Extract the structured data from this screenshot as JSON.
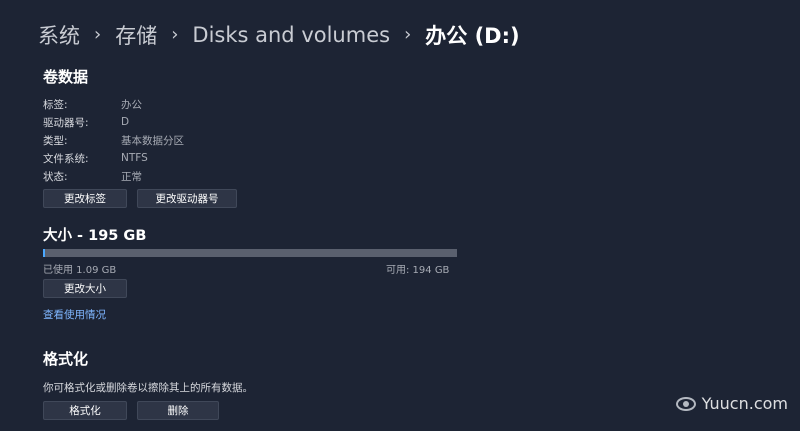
{
  "breadcrumb": {
    "items": [
      "系统",
      "存储",
      "Disks and volumes",
      "办公 (D:)"
    ],
    "separator": "›"
  },
  "volume_data": {
    "title": "卷数据",
    "properties": [
      {
        "label": "标签:",
        "value": "办公"
      },
      {
        "label": "驱动器号:",
        "value": "D"
      },
      {
        "label": "类型:",
        "value": "基本数据分区"
      },
      {
        "label": "文件系统:",
        "value": "NTFS"
      },
      {
        "label": "状态:",
        "value": "正常"
      }
    ],
    "change_label_button": "更改标签",
    "change_drive_letter_button": "更改驱动器号"
  },
  "size": {
    "title": "大小 - 195 GB",
    "used_text": "已使用 1.09 GB",
    "free_text": "可用: 194 GB",
    "used_fraction": 0.0056,
    "resize_button": "更改大小",
    "view_usage_link": "查看使用情况"
  },
  "format": {
    "title": "格式化",
    "description": "你可格式化或删除卷以擦除其上的所有数据。",
    "format_button": "格式化",
    "delete_button": "删除"
  },
  "watermark": {
    "text": "Yuucn.com"
  },
  "colors": {
    "background": "#1d2434",
    "accent": "#4aa8ff",
    "link": "#7fb6ff"
  }
}
